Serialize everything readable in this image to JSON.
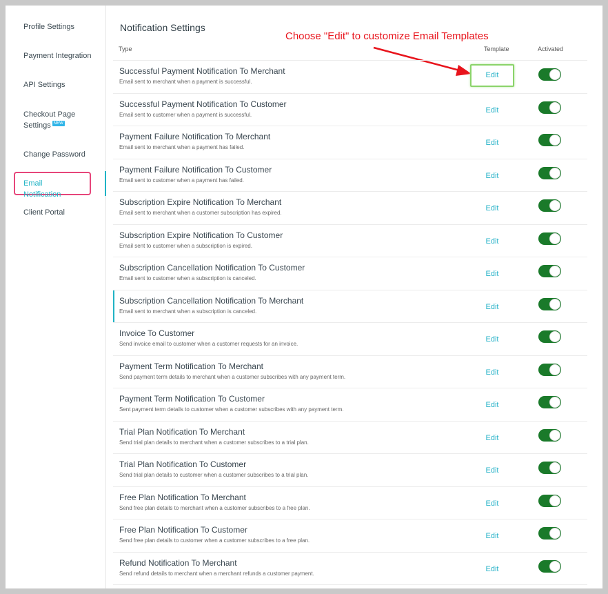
{
  "sidebar": {
    "items": [
      {
        "label": "Profile Settings"
      },
      {
        "label": "Payment Integration"
      },
      {
        "label": "API Settings"
      },
      {
        "label": "Checkout Page Settings",
        "badge": "NEW"
      },
      {
        "label": "Change Password"
      },
      {
        "label": "Email Notification",
        "active": true
      },
      {
        "label": "Client Portal"
      }
    ]
  },
  "main": {
    "title": "Notification Settings",
    "annotation": "Choose \"Edit\" to customize Email Templates",
    "columns": {
      "type": "Type",
      "template": "Template",
      "activated": "Activated"
    },
    "edit_label": "Edit",
    "rows": [
      {
        "title": "Successful Payment Notification To Merchant",
        "desc": "Email sent to merchant when a payment is successful.",
        "activated": true
      },
      {
        "title": "Successful Payment Notification To Customer",
        "desc": "Email sent to customer when a payment is successful.",
        "activated": true
      },
      {
        "title": "Payment Failure Notification To Merchant",
        "desc": "Email sent to merchant when a payment has failed.",
        "activated": true
      },
      {
        "title": "Payment Failure Notification To Customer",
        "desc": "Email sent to customer when a payment has failed.",
        "activated": true
      },
      {
        "title": "Subscription Expire Notification To Merchant",
        "desc": "Email sent to merchant when a customer subscription has expired.",
        "activated": true
      },
      {
        "title": "Subscription Expire Notification To Customer",
        "desc": "Email sent to customer when a subscription is expired.",
        "activated": true
      },
      {
        "title": "Subscription Cancellation Notification To Customer",
        "desc": "Email sent to customer when a subscription is canceled.",
        "activated": true
      },
      {
        "title": "Subscription Cancellation Notification To Merchant",
        "desc": "Email sent to merchant when a subscription is canceled.",
        "activated": true
      },
      {
        "title": "Invoice To Customer",
        "desc": "Send invoice email to customer when a customer requests for an invoice.",
        "activated": true
      },
      {
        "title": "Payment Term Notification To Merchant",
        "desc": "Send payment term details to merchant when a customer subscribes with any payment term.",
        "activated": true
      },
      {
        "title": "Payment Term Notification To Customer",
        "desc": "Sent payment term details to customer when a customer subscribes with any payment term.",
        "activated": true
      },
      {
        "title": "Trial Plan Notification To Merchant",
        "desc": "Send trial plan details to merchant when a customer subscribes to a trial plan.",
        "activated": true
      },
      {
        "title": "Trial Plan Notification To Customer",
        "desc": "Send trial plan details to customer when a customer subscribes to a trial plan.",
        "activated": true
      },
      {
        "title": "Free Plan Notification To Merchant",
        "desc": "Send free plan details to merchant when a customer subscribes to a free plan.",
        "activated": true
      },
      {
        "title": "Free Plan Notification To Customer",
        "desc": "Send free plan details to customer when a customer subscribes to a free plan.",
        "activated": true
      },
      {
        "title": "Refund Notification To Merchant",
        "desc": "Send refund details to merchant when a merchant refunds a customer payment.",
        "activated": true
      }
    ]
  },
  "colors": {
    "accent": "#1fb3c5",
    "toggle_on": "#1a7a2a",
    "annotation": "#e8141c",
    "active_outline": "#e6457a",
    "edit_highlight": "#8bd46a"
  }
}
